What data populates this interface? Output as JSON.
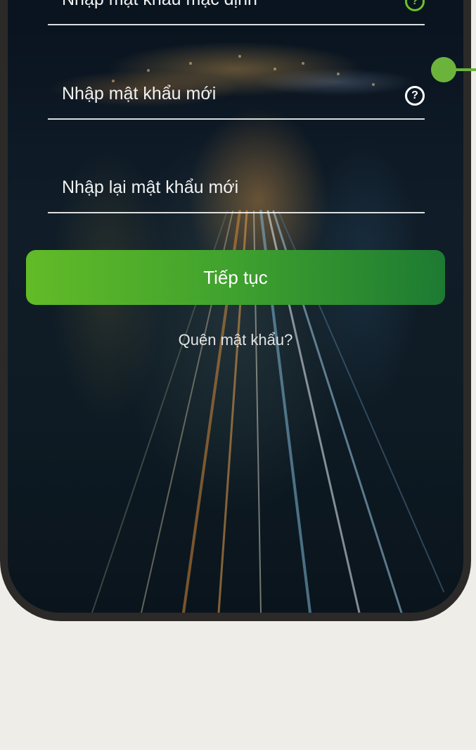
{
  "form": {
    "default_password_placeholder": "Nhập mật khẩu mặc định",
    "new_password_placeholder": "Nhập mật khẩu mới",
    "confirm_password_placeholder": "Nhập lại mật khẩu mới",
    "help_symbol": "?"
  },
  "actions": {
    "continue_label": "Tiếp tục",
    "forgot_password_label": "Quên mật khẩu?"
  },
  "colors": {
    "accent_green": "#6cc12a",
    "button_gradient_start": "#62bb27",
    "button_gradient_end": "#1d7a32",
    "page_background": "#efede8"
  }
}
